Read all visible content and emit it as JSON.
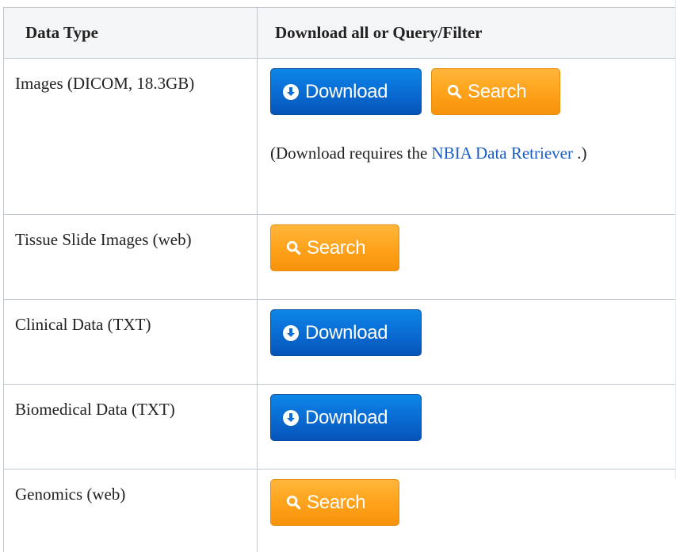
{
  "table": {
    "headers": {
      "data_type": "Data Type",
      "download": "Download all or Query/Filter"
    },
    "rows": [
      {
        "type": "Images (DICOM, 18.3GB)",
        "download_label": "Download",
        "search_label": "Search",
        "note_prefix": "(Download requires the ",
        "note_link": "NBIA Data Retriever",
        "note_suffix": " .)"
      },
      {
        "type": "Tissue Slide Images (web)",
        "search_label": "Search"
      },
      {
        "type": "Clinical Data (TXT)",
        "download_label": "Download"
      },
      {
        "type": "Biomedical Data (TXT)",
        "download_label": "Download"
      },
      {
        "type": "Genomics (web)",
        "search_label": "Search"
      }
    ]
  },
  "icons": {
    "download": "download-circle-icon",
    "search": "magnifier-icon"
  },
  "colors": {
    "download_button": "#0a6fd6",
    "search_button": "#ffa31c",
    "link": "#1b5dc7",
    "header_bg": "#f4f5f7",
    "border": "#c1c7d0"
  }
}
